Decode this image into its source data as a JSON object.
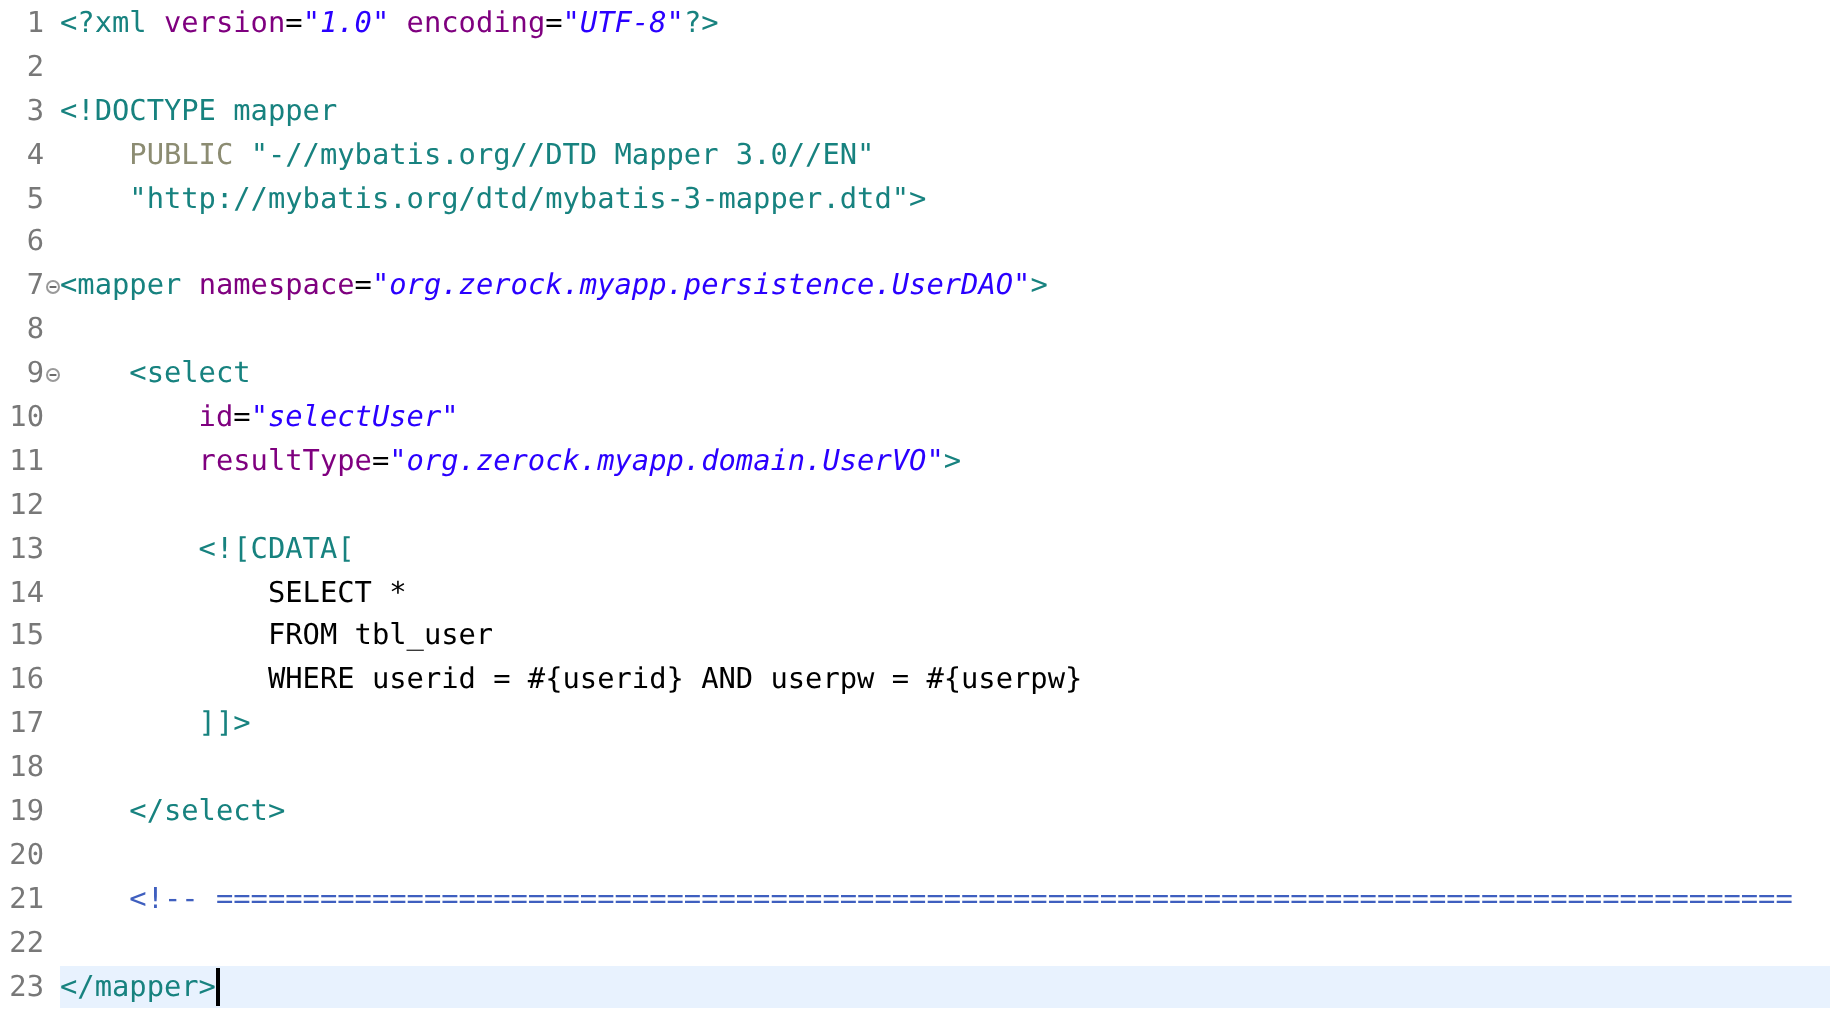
{
  "editor": {
    "lines": [
      {
        "number": "1",
        "fold": false,
        "current": false,
        "tokens": [
          {
            "kind": "tag",
            "text": "<?xml "
          },
          {
            "kind": "attr",
            "text": "version"
          },
          {
            "kind": "plain",
            "text": "="
          },
          {
            "kind": "value",
            "text": "\"1.0\""
          },
          {
            "kind": "attr",
            "text": " encoding"
          },
          {
            "kind": "plain",
            "text": "="
          },
          {
            "kind": "value",
            "text": "\"UTF-8\""
          },
          {
            "kind": "tag",
            "text": "?>"
          }
        ]
      },
      {
        "number": "2",
        "fold": false,
        "current": false
      },
      {
        "number": "3",
        "fold": false,
        "current": false,
        "tokens": [
          {
            "kind": "tag",
            "text": "<!DOCTYPE mapper"
          }
        ]
      },
      {
        "number": "4",
        "fold": false,
        "current": false,
        "tokens": [
          {
            "kind": "keyword",
            "text": "    PUBLIC "
          },
          {
            "kind": "doctype-string",
            "text": "\"-//mybatis.org//DTD Mapper 3.0//EN\""
          }
        ]
      },
      {
        "number": "5",
        "fold": false,
        "current": false,
        "tokens": [
          {
            "kind": "doctype-string",
            "text": "    \"http://mybatis.org/dtd/mybatis-3-mapper.dtd\""
          },
          {
            "kind": "tag",
            "text": ">"
          }
        ]
      },
      {
        "number": "6",
        "fold": false,
        "current": false
      },
      {
        "number": "7",
        "fold": true,
        "current": false,
        "tokens": [
          {
            "kind": "tag",
            "text": "<mapper "
          },
          {
            "kind": "attr",
            "text": "namespace"
          },
          {
            "kind": "plain",
            "text": "="
          },
          {
            "kind": "value",
            "text": "\"org.zerock.myapp.persistence.UserDAO\""
          },
          {
            "kind": "tag",
            "text": ">"
          }
        ]
      },
      {
        "number": "8",
        "fold": false,
        "current": false
      },
      {
        "number": "9",
        "fold": true,
        "current": false,
        "tokens": [
          {
            "kind": "tag",
            "text": "    <select"
          }
        ]
      },
      {
        "number": "10",
        "fold": false,
        "current": false,
        "tokens": [
          {
            "kind": "attr",
            "text": "        id"
          },
          {
            "kind": "plain",
            "text": "="
          },
          {
            "kind": "value",
            "text": "\"selectUser\""
          }
        ]
      },
      {
        "number": "11",
        "fold": false,
        "current": false,
        "tokens": [
          {
            "kind": "attr",
            "text": "        resultType"
          },
          {
            "kind": "plain",
            "text": "="
          },
          {
            "kind": "value",
            "text": "\"org.zerock.myapp.domain.UserVO\""
          },
          {
            "kind": "tag",
            "text": ">"
          }
        ]
      },
      {
        "number": "12",
        "fold": false,
        "current": false
      },
      {
        "number": "13",
        "fold": false,
        "current": false,
        "tokens": [
          {
            "kind": "tag",
            "text": "        <![CDATA["
          }
        ]
      },
      {
        "number": "14",
        "fold": false,
        "current": false,
        "tokens": [
          {
            "kind": "plain",
            "text": "            SELECT *"
          }
        ]
      },
      {
        "number": "15",
        "fold": false,
        "current": false,
        "tokens": [
          {
            "kind": "plain",
            "text": "            FROM tbl_user"
          }
        ]
      },
      {
        "number": "16",
        "fold": false,
        "current": false,
        "tokens": [
          {
            "kind": "plain",
            "text": "            WHERE userid = #{userid} AND userpw = #{userpw}"
          }
        ]
      },
      {
        "number": "17",
        "fold": false,
        "current": false,
        "tokens": [
          {
            "kind": "tag",
            "text": "        ]]>"
          }
        ]
      },
      {
        "number": "18",
        "fold": false,
        "current": false
      },
      {
        "number": "19",
        "fold": false,
        "current": false,
        "tokens": [
          {
            "kind": "tag",
            "text": "    </select>"
          }
        ]
      },
      {
        "number": "20",
        "fold": false,
        "current": false
      },
      {
        "number": "21",
        "fold": false,
        "current": false,
        "tokens": [
          {
            "kind": "comment",
            "text": "    <!-- ==========================================================================================="
          }
        ]
      },
      {
        "number": "22",
        "fold": false,
        "current": false
      },
      {
        "number": "23",
        "fold": false,
        "current": true,
        "tokens": [
          {
            "kind": "tag",
            "text": "</mapper>"
          }
        ]
      }
    ]
  }
}
